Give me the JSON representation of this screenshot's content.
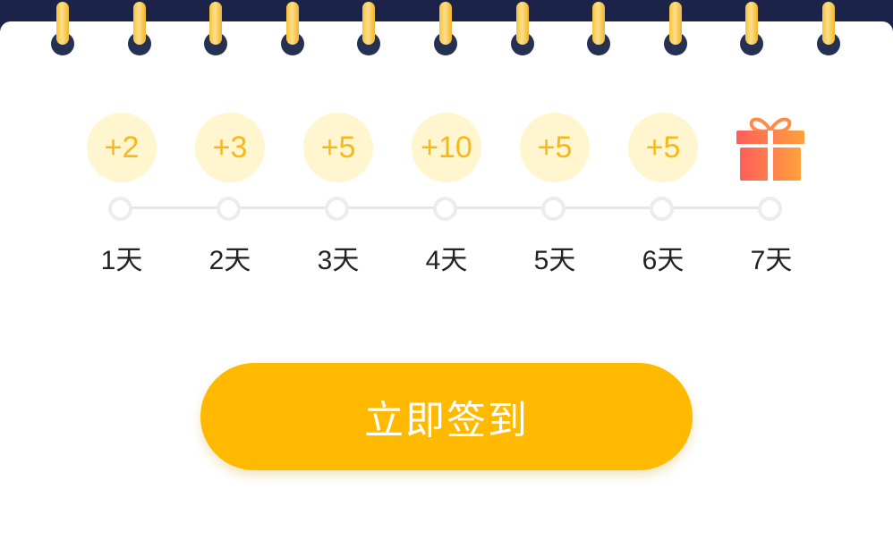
{
  "colors": {
    "header_background": "#1b2448",
    "card_background": "#ffffff",
    "ring_gold": "#f8c23c",
    "reward_text": "#f8b81a",
    "reward_circle": "#fff6cf",
    "button_background": "#ffba00",
    "gift_gradient": [
      "#ff5e5b",
      "#ffa13c"
    ]
  },
  "rewards": [
    "+2",
    "+3",
    "+5",
    "+10",
    "+5",
    "+5"
  ],
  "final_reward_icon": "gift-icon",
  "days": [
    "1天",
    "2天",
    "3天",
    "4天",
    "5天",
    "6天",
    "7天"
  ],
  "sign_button_label": "立即签到"
}
